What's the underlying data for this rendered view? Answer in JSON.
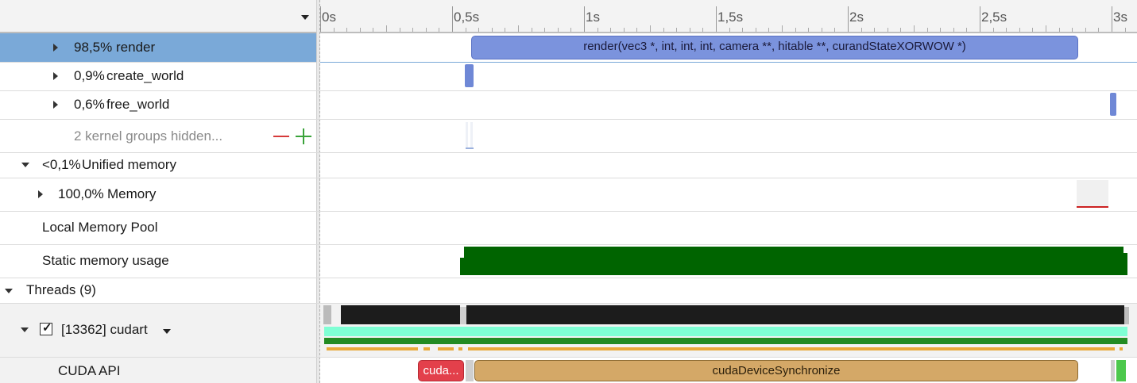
{
  "axis": {
    "ticks": [
      "0s",
      "0,5s",
      "1s",
      "1,5s",
      "2s",
      "2,5s",
      "3s"
    ]
  },
  "rows": {
    "render": {
      "pct": "98,5%",
      "name": "render"
    },
    "create_world": {
      "pct": "0,9%",
      "name": "create_world"
    },
    "free_world": {
      "pct": "0,6%",
      "name": "free_world"
    },
    "hidden": {
      "label": "2 kernel groups hidden..."
    },
    "unified": {
      "pct": "<0,1%",
      "name": "Unified memory"
    },
    "memory": {
      "pct": "100,0%",
      "name": "Memory"
    },
    "local_pool": {
      "label": "Local Memory Pool"
    },
    "static_mem": {
      "label": "Static memory usage"
    },
    "threads": {
      "label": "Threads (9)"
    },
    "cudart": {
      "label": "[13362] cudart",
      "checked": true
    },
    "cuda_api": {
      "label": "CUDA API"
    }
  },
  "timeline": {
    "render_kernel": "render(vec3 *, int, int, int, camera **, hitable **, curandStateXORWOW *)",
    "cuda_red": "cuda...",
    "cuda_sync": "cudaDeviceSynchronize"
  },
  "colors": {
    "selected_row": "#7aa9d8",
    "kernel_bar": "#7b93dd",
    "static_mem": "#006400",
    "api_red": "#e3404b",
    "api_sync": "#d4a867",
    "thread_teal": "#7fffd4",
    "thread_green": "#228b22",
    "thread_orange": "#e8a93a"
  }
}
